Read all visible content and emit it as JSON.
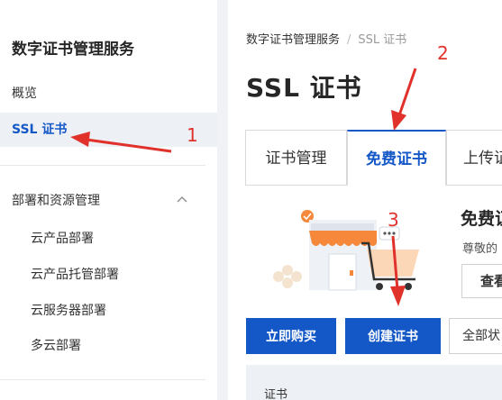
{
  "sidebar": {
    "title": "数字证书管理服务",
    "items": [
      {
        "label": "概览"
      },
      {
        "label": "SSL 证书"
      }
    ],
    "group": {
      "label": "部署和资源管理",
      "children": [
        {
          "label": "云产品部署"
        },
        {
          "label": "云产品托管部署"
        },
        {
          "label": "云服务器部署"
        },
        {
          "label": "多云部署"
        }
      ]
    }
  },
  "main": {
    "breadcrumb": {
      "root": "数字证书管理服务",
      "sep": "/",
      "current": "SSL 证书"
    },
    "title": "SSL 证书",
    "tabs": [
      {
        "label": "证书管理"
      },
      {
        "label": "免费证书"
      },
      {
        "label": "上传证"
      }
    ],
    "promo": {
      "title": "免费证",
      "desc": "尊敬的",
      "view_button": "查看"
    },
    "actions": {
      "buy": "立即购买",
      "create": "创建证书",
      "status_select": "全部状"
    },
    "table": {
      "columns": [
        "证书"
      ]
    }
  },
  "annotations": {
    "numbers": [
      "1",
      "2",
      "3"
    ],
    "color": "#e0312b"
  },
  "colors": {
    "accent": "#1458c8",
    "sidebar_active_bg": "#edf0f5",
    "illustration_orange": "#f5883a"
  }
}
